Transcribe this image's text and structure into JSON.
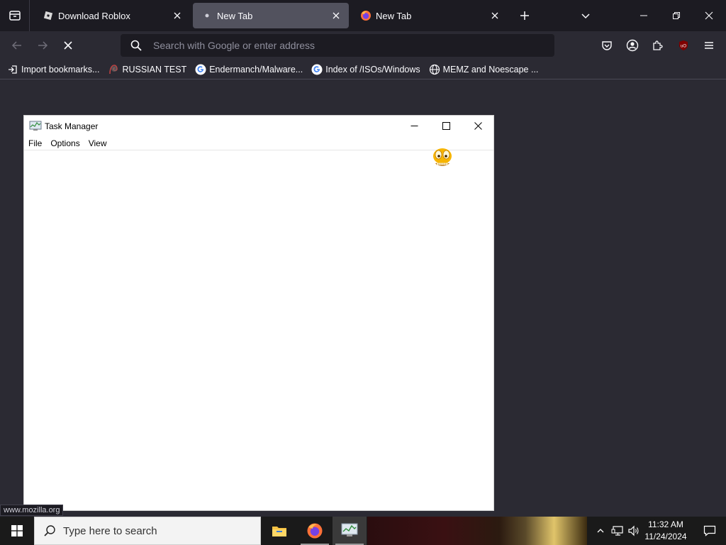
{
  "browser": {
    "tabs": [
      {
        "label": "Download Roblox",
        "favicon": "roblox-icon",
        "selected": false
      },
      {
        "label": "New Tab",
        "favicon": "dot-icon",
        "selected": true
      },
      {
        "label": "New Tab",
        "favicon": "firefox-icon",
        "selected": false
      }
    ],
    "urlbar": {
      "placeholder": "Search with Google or enter address",
      "value": ""
    },
    "bookmarks": [
      {
        "label": "Import bookmarks...",
        "icon": "import-icon"
      },
      {
        "label": "RUSSIAN TEST",
        "icon": "russian-test-icon"
      },
      {
        "label": "Endermanch/Malware...",
        "icon": "google-icon"
      },
      {
        "label": "Index of /ISOs/Windows",
        "icon": "google-icon"
      },
      {
        "label": "MEMZ and Noescape ...",
        "icon": "globe-icon"
      }
    ],
    "status_text": "www.mozilla.org",
    "colors": {
      "toolbar": "#2b2a33",
      "tabstrip": "#1c1b22",
      "selected_tab": "#52525e"
    }
  },
  "task_manager": {
    "title": "Task Manager",
    "menu": [
      "File",
      "Options",
      "View"
    ]
  },
  "taskbar": {
    "search_placeholder": "Type here to search",
    "apps": [
      "file-explorer-icon",
      "firefox-icon",
      "task-manager-icon"
    ],
    "time": "11:32 AM",
    "date": "11/24/2024"
  }
}
